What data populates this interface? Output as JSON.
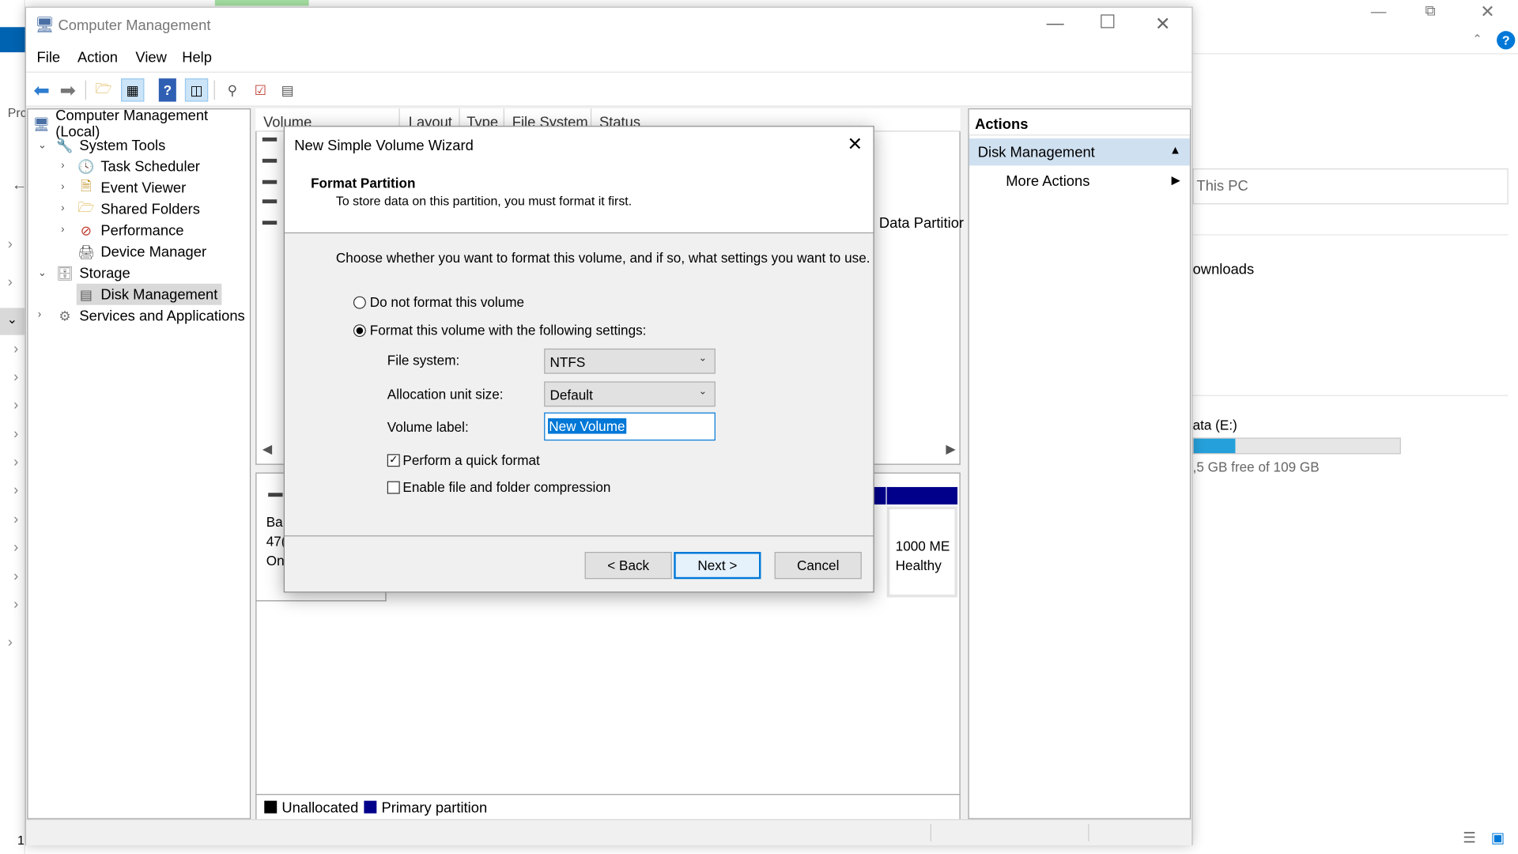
{
  "background": {
    "address_text": "This PC",
    "downloads_label": "ownloads",
    "drive_label": "ata (E:)",
    "drive_free": ",5 GB free of 109 GB",
    "drive_used_fraction": 0.2,
    "left_partial_text": "Prc",
    "bottom_partial_text": "1"
  },
  "window": {
    "title": "Computer Management",
    "menu": [
      "File",
      "Action",
      "View",
      "Help"
    ],
    "tree": {
      "root": "Computer Management (Local)",
      "system_tools": "System Tools",
      "task_scheduler": "Task Scheduler",
      "event_viewer": "Event Viewer",
      "shared_folders": "Shared Folders",
      "performance": "Performance",
      "device_manager": "Device Manager",
      "storage": "Storage",
      "disk_management": "Disk Management",
      "services": "Services and Applications"
    },
    "columns": [
      "Volume",
      "Layout",
      "Type",
      "File System",
      "Status"
    ],
    "volume_status_partial": "Data Partitior",
    "disk_info": [
      "Ba",
      "47(",
      "On"
    ],
    "partition_info": {
      "size": "1000 ME",
      "status": "Healthy"
    },
    "legend": {
      "unallocated": "Unallocated",
      "primary": "Primary partition"
    },
    "actions": {
      "header": "Actions",
      "section": "Disk Management",
      "more": "More Actions"
    }
  },
  "dialog": {
    "title": "New Simple Volume Wizard",
    "heading": "Format Partition",
    "subheading": "To store data on this partition, you must format it first.",
    "instruction": "Choose whether you want to format this volume, and if so, what settings you want to use.",
    "option_no_format": "Do not format this volume",
    "option_format": "Format this volume with the following settings:",
    "file_system_label": "File system:",
    "file_system_value": "NTFS",
    "allocation_label": "Allocation unit size:",
    "allocation_value": "Default",
    "volume_label_label": "Volume label:",
    "volume_label_value": "New Volume",
    "quick_format": "Perform a quick format",
    "compression": "Enable file and folder compression",
    "back": "< Back",
    "next": "Next >",
    "cancel": "Cancel"
  },
  "colors": {
    "accent": "#0078d7",
    "primary_partition": "#00008b",
    "selection": "#cce8ff"
  }
}
